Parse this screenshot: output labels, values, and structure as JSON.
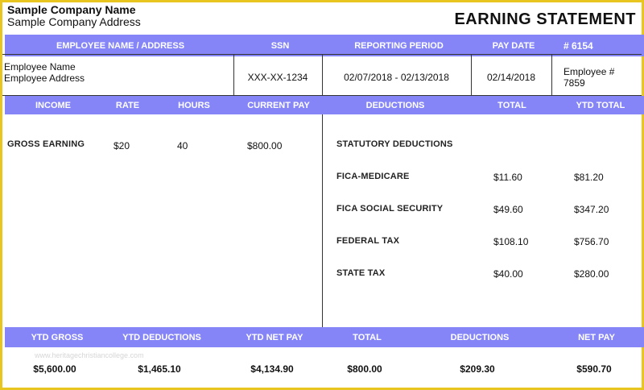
{
  "company": {
    "name": "Sample Company Name",
    "address": "Sample Company Address",
    "statement_title": "EARNING STATEMENT"
  },
  "info_header": {
    "employee_name_address": "EMPLOYEE NAME / ADDRESS",
    "ssn": "SSN",
    "reporting_period": "REPORTING PERIOD",
    "pay_date": "PAY DATE",
    "check_number": "# 6154"
  },
  "info_row": {
    "employee_name": "Employee Name",
    "employee_address": "Employee Address",
    "ssn": "XXX-XX-1234",
    "reporting_period": "02/07/2018 - 02/13/2018",
    "pay_date": "02/14/2018",
    "employee_number_label": "Employee #",
    "employee_number": "7859"
  },
  "detail_header": {
    "income": "INCOME",
    "rate": "RATE",
    "hours": "HOURS",
    "current_pay": "CURRENT PAY",
    "deductions": "DEDUCTIONS",
    "total": "TOTAL",
    "ytd_total": "YTD TOTAL"
  },
  "income": {
    "label": "GROSS EARNING",
    "rate": "$20",
    "hours": "40",
    "current_pay": "$800.00"
  },
  "deductions": {
    "section_label": "STATUTORY DEDUCTIONS",
    "items": [
      {
        "name": "FICA-MEDICARE",
        "total": "$11.60",
        "ytd": "$81.20"
      },
      {
        "name": "FICA SOCIAL SECURITY",
        "total": "$49.60",
        "ytd": "$347.20"
      },
      {
        "name": "FEDERAL TAX",
        "total": "$108.10",
        "ytd": "$756.70"
      },
      {
        "name": "STATE TAX",
        "total": "$40.00",
        "ytd": "$280.00"
      }
    ]
  },
  "summary_header": {
    "ytd_gross": "YTD GROSS",
    "ytd_deductions": "YTD DEDUCTIONS",
    "ytd_net_pay": "YTD NET PAY",
    "total": "TOTAL",
    "deductions": "DEDUCTIONS",
    "net_pay": "NET PAY"
  },
  "summary_values": {
    "ytd_gross": "$5,600.00",
    "ytd_deductions": "$1,465.10",
    "ytd_net_pay": "$4,134.90",
    "total": "$800.00",
    "deductions": "$209.30",
    "net_pay": "$590.70"
  },
  "watermark": "www.heritagechristiancollege.com",
  "colors": {
    "band": "#8585f8",
    "frame": "#e8c51f"
  }
}
